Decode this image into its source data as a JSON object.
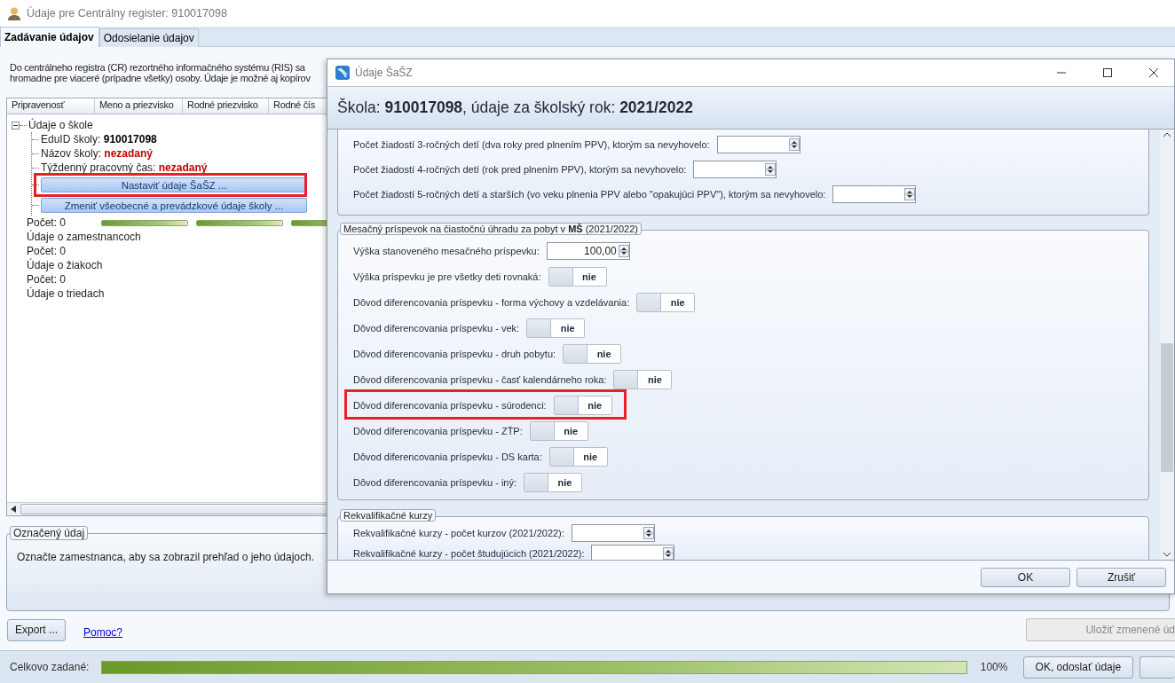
{
  "window": {
    "title": "Údaje pre Centrálny register: 910017098"
  },
  "tabs": [
    {
      "label": "Zadávanie údajov",
      "selected": true
    },
    {
      "label": "Odosielanie údajov",
      "selected": false
    }
  ],
  "description": [
    "Do centrálneho registra (CR) rezortného informačného systému (RIS) sa",
    "hromadne pre viaceré (prípadne všetky) osoby. Údaje je možné aj kopírov"
  ],
  "table": {
    "columns": [
      "Pripravenosť",
      "Meno a priezvisko",
      "Rodné priezvisko",
      "Rodné čís"
    ],
    "tree": [
      {
        "label": "Údaje o škole",
        "expanded": true,
        "children": [
          {
            "kind": "field",
            "label": "EduID školy:",
            "value": "910017098",
            "missing": false
          },
          {
            "kind": "field",
            "label": "Názov školy:",
            "value": "nezadaný",
            "missing": true
          },
          {
            "kind": "field",
            "label": "Týždenný pracovný čas:",
            "value": "nezadaný",
            "missing": true
          },
          {
            "kind": "button",
            "label": "Nastaviť údaje ŠaŠZ ...",
            "highlighted": true
          },
          {
            "kind": "button",
            "label": "Zmeniť všeobecné a prevádzkové údaje školy ...",
            "highlighted": false
          }
        ]
      }
    ],
    "rows": [
      {
        "kind": "count",
        "label": "Počet: 0",
        "bars": [
          {
            "level": 1
          },
          {
            "level": 1
          },
          {
            "level": 1
          }
        ]
      },
      {
        "kind": "section",
        "label": "Údaje o zamestnancoch"
      },
      {
        "kind": "count",
        "label": "Počet: 0"
      },
      {
        "kind": "section",
        "label": "Údaje o žiakoch"
      },
      {
        "kind": "count",
        "label": "Počet: 0"
      },
      {
        "kind": "section",
        "label": "Údaje o triedach"
      }
    ]
  },
  "selected_item": {
    "title": "Označený údaj",
    "text": "Označte zamestnanca, aby sa zobrazil prehľad o jeho údajoch."
  },
  "actions": {
    "export": "Export ...",
    "help_link": "Pomoc?",
    "save": {
      "label": "Uložiť zmenené úd",
      "disabled": true
    }
  },
  "status_bar": {
    "label": "Celkovo zadané:",
    "level": 1,
    "reading": "100%",
    "send_button": "OK, odoslať údaje"
  },
  "dialog": {
    "title": "Údaje ŠaŠZ",
    "heading": "Škola: **910017098**, údaje za školský rok: **2021/2022**",
    "groups": [
      {
        "rows": [
          {
            "kind": "spinner",
            "label": "Počet žiadostí 3-ročných detí (dva roky pred plnením PPV), ktorým sa nevyhovelo:",
            "highlighted": false
          },
          {
            "kind": "spinner",
            "label": "Počet žiadostí 4-ročných detí (rok pred plnením PPV), ktorým sa nevyhovelo:",
            "highlighted": false
          },
          {
            "kind": "spinner",
            "label": "Počet žiadostí 5-ročných detí a starších (vo veku plnenia PPV alebo \"opakujúci PPV\"), ktorým sa nevyhovelo:",
            "highlighted": false
          }
        ]
      },
      {
        "title": "Mesačný príspevok na čiastočnú úhradu za pobyt v **MŠ** (2021/2022)",
        "rows": [
          {
            "kind": "spinner",
            "label": "Výška stanoveného mesačného príspevku:",
            "value": "100,00",
            "highlighted": false
          },
          {
            "kind": "toggle",
            "label": "Výška príspevku je pre všetky deti rovnaká:",
            "on": false,
            "state_text": "nie",
            "highlighted": false
          },
          {
            "kind": "toggle",
            "label": "Dôvod diferencovania príspevku - forma výchovy a vzdelávania:",
            "on": false,
            "state_text": "nie",
            "highlighted": false
          },
          {
            "kind": "toggle",
            "label": "Dôvod diferencovania príspevku - vek:",
            "on": false,
            "state_text": "nie",
            "highlighted": false
          },
          {
            "kind": "toggle",
            "label": "Dôvod diferencovania príspevku - druh pobytu:",
            "on": false,
            "state_text": "nie",
            "highlighted": false
          },
          {
            "kind": "toggle",
            "label": "Dôvod diferencovania príspevku - časť kalendárneho roka:",
            "on": false,
            "state_text": "nie",
            "highlighted": false
          },
          {
            "kind": "toggle",
            "label": "Dôvod diferencovania príspevku - súrodenci:",
            "on": false,
            "state_text": "nie",
            "highlighted": true
          },
          {
            "kind": "toggle",
            "label": "Dôvod diferencovania príspevku - ZŤP:",
            "on": false,
            "state_text": "nie",
            "highlighted": false
          },
          {
            "kind": "toggle",
            "label": "Dôvod diferencovania príspevku - DS karta:",
            "on": false,
            "state_text": "nie",
            "highlighted": false
          },
          {
            "kind": "toggle",
            "label": "Dôvod diferencovania príspevku - iný:",
            "on": false,
            "state_text": "nie",
            "highlighted": false
          }
        ]
      },
      {
        "title": "Rekvalifikačné kurzy",
        "rows": [
          {
            "kind": "spinner",
            "label": "Rekvalifikačné kurzy - počet kurzov (2021/2022):",
            "highlighted": false
          },
          {
            "kind": "spinner",
            "label": "Rekvalifikačné kurzy - počet študujúcich (2021/2022):",
            "highlighted": false
          }
        ]
      }
    ],
    "buttons": [
      "OK",
      "Zrušiť"
    ]
  }
}
